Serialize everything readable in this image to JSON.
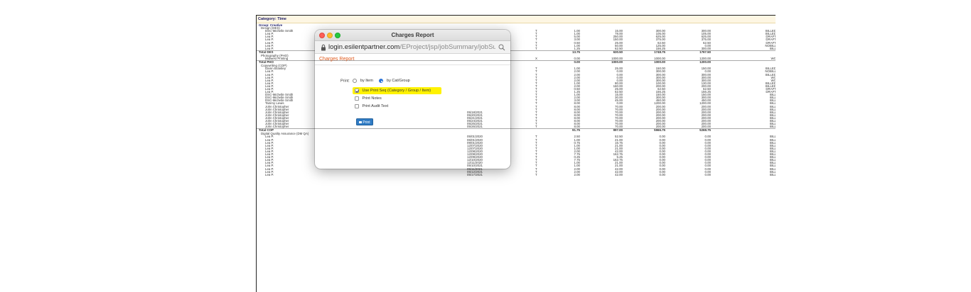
{
  "report": {
    "category": "Category: Time",
    "rows": [
      {
        "k": "h",
        "name": "Group: Creative"
      },
      {
        "k": "h1",
        "name": "Design (DES)"
      },
      {
        "k": "d",
        "name": "DSC-Michelle Smith",
        "type": "T",
        "hrs": "1.00",
        "rate": "15.00",
        "amt": "300.00",
        "bill": "300.00",
        "stat": "BILLED"
      },
      {
        "k": "d",
        "name": "Lea P.",
        "type": "T",
        "hrs": "1.00",
        "rate": "78.00",
        "amt": "105.00",
        "bill": "105.00",
        "stat": "BILLED"
      },
      {
        "k": "d",
        "name": "Lea P.",
        "type": "T",
        "hrs": "5.00",
        "rate": "250.00",
        "amt": "625.00",
        "bill": "625.00",
        "stat": "DRAFT"
      },
      {
        "k": "d",
        "name": "Lea P.",
        "type": "T",
        "hrs": "3.00",
        "rate": "150.00",
        "amt": "375.00",
        "bill": "375.00",
        "stat": "DRAFT"
      },
      {
        "k": "d",
        "name": "Lea P.",
        "type": "T",
        "hrs": "0.50",
        "rate": "25.00",
        "amt": "62.50",
        "bill": "62.50",
        "stat": "DRAFT"
      },
      {
        "k": "d",
        "name": "Lea P.",
        "type": "T",
        "hrs": "1.00",
        "rate": "50.00",
        "amt": "125.00",
        "bill": "0.00",
        "stat": "NOBILL"
      },
      {
        "k": "d",
        "name": "Lea P.",
        "type": "T",
        "hrs": "1.25",
        "rate": "62.50",
        "amt": "156.25",
        "bill": "300.00",
        "stat": "BILL"
      },
      {
        "k": "tot",
        "name": "Total DES",
        "hrs": "13.75",
        "rate": "630.50",
        "amt": "1748.75",
        "bill": "1767.50"
      },
      {
        "k": "gap"
      },
      {
        "k": "h2",
        "name": "Photography (PHO)"
      },
      {
        "k": "d",
        "name": "Midwest Printing",
        "type": "X",
        "hrs": "0.00",
        "rate": "1000.00",
        "amt": "1000.00",
        "bill": "1200.00",
        "stat": "WO"
      },
      {
        "k": "tot",
        "name": "Total PHO",
        "hrs": "0.00",
        "rate": "1000.00",
        "amt": "1000.00",
        "bill": "1200.00"
      },
      {
        "k": "gap"
      },
      {
        "k": "h2",
        "name": "Copywriting (COP)"
      },
      {
        "k": "d",
        "name": "Damn Brantley",
        "type": "T",
        "hrs": "1.00",
        "rate": "25.00",
        "amt": "150.00",
        "bill": "150.00",
        "stat": "BILLED"
      },
      {
        "k": "d",
        "name": "Lea P.",
        "type": "T",
        "hrs": "2.00",
        "rate": "0.00",
        "amt": "300.00",
        "bill": "0.00",
        "stat": "NOBILL"
      },
      {
        "k": "d",
        "name": "Lea P.",
        "type": "T",
        "hrs": "2.00",
        "rate": "0.00",
        "amt": "300.00",
        "bill": "300.00",
        "stat": "BILLED"
      },
      {
        "k": "d",
        "name": "Lea P.",
        "type": "T",
        "hrs": "2.00",
        "rate": "0.00",
        "amt": "300.00",
        "bill": "300.00",
        "stat": "WO"
      },
      {
        "k": "d",
        "name": "Lea P.",
        "type": "T",
        "hrs": "2.00",
        "rate": "0.00",
        "amt": "300.00",
        "bill": "300.00",
        "stat": "WO"
      },
      {
        "k": "d",
        "name": "Lea P.",
        "type": "T",
        "hrs": "1.00",
        "rate": "80.00",
        "amt": "100.00",
        "bill": "130.00",
        "stat": "BILLED"
      },
      {
        "k": "d",
        "name": "Lea P.",
        "type": "T",
        "hrs": "2.00",
        "rate": "160.00",
        "amt": "200.00",
        "bill": "200.00",
        "stat": "BILLED"
      },
      {
        "k": "d",
        "name": "Lea P.",
        "type": "T",
        "hrs": "0.50",
        "rate": "25.00",
        "amt": "62.50",
        "bill": "62.50",
        "stat": "DRAFT"
      },
      {
        "k": "d",
        "name": "Lea P.",
        "type": "T",
        "hrs": "1.25",
        "rate": "62.50",
        "amt": "156.25",
        "bill": "156.25",
        "stat": "DRAFT"
      },
      {
        "k": "d",
        "name": "DSC-Michelle Smith",
        "type": "T",
        "hrs": "1.00",
        "rate": "15.00",
        "amt": "150.00",
        "bill": "150.00",
        "stat": "BILL"
      },
      {
        "k": "d",
        "name": "DSC-Michelle Smith",
        "type": "T",
        "hrs": "2.00",
        "rate": "30.00",
        "amt": "300.00",
        "bill": "300.00",
        "stat": "BILL"
      },
      {
        "k": "d",
        "name": "DSC-Michelle Smith",
        "type": "T",
        "hrs": "3.00",
        "rate": "45.00",
        "amt": "450.00",
        "bill": "450.00",
        "stat": "BILL"
      },
      {
        "k": "d",
        "name": "Tammy Lewis",
        "type": "T",
        "hrs": "8.00",
        "rate": "0.00",
        "amt": "1200.00",
        "bill": "1200.00",
        "stat": "BILL"
      },
      {
        "k": "d",
        "name": "John Christopher",
        "type": "T",
        "hrs": "8.00",
        "rate": "70.00",
        "amt": "200.00",
        "bill": "200.00",
        "stat": "BILL"
      },
      {
        "k": "d",
        "name": "John Christopher",
        "type": "T",
        "hrs": "8.00",
        "rate": "70.00",
        "amt": "200.00",
        "bill": "200.00",
        "stat": "BILL"
      },
      {
        "k": "d",
        "name": "John Christopher",
        "date": "05/18/2021",
        "type": "T",
        "hrs": "8.00",
        "rate": "70.00",
        "amt": "200.00",
        "bill": "200.00",
        "stat": "BILL"
      },
      {
        "k": "d",
        "name": "John Christopher",
        "date": "05/20/2021",
        "type": "T",
        "hrs": "8.00",
        "rate": "70.00",
        "amt": "200.00",
        "bill": "200.00",
        "stat": "BILL"
      },
      {
        "k": "d",
        "name": "John Christopher",
        "date": "05/21/2021",
        "type": "T",
        "hrs": "8.00",
        "rate": "70.00",
        "amt": "200.00",
        "bill": "200.00",
        "stat": "BILL"
      },
      {
        "k": "d",
        "name": "John Christopher",
        "date": "05/24/2021",
        "type": "T",
        "hrs": "8.00",
        "rate": "70.00",
        "amt": "200.00",
        "bill": "200.00",
        "stat": "BILL"
      },
      {
        "k": "d",
        "name": "John Christopher",
        "date": "05/25/2021",
        "type": "T",
        "hrs": "8.00",
        "rate": "70.00",
        "amt": "200.00",
        "bill": "200.00",
        "stat": "BILL"
      },
      {
        "k": "d",
        "name": "John Christopher",
        "date": "05/26/2021",
        "type": "T",
        "hrs": "8.00",
        "rate": "70.00",
        "amt": "200.00",
        "bill": "200.00",
        "stat": "BILL"
      },
      {
        "k": "tot",
        "name": "Total COP",
        "hrs": "91.75",
        "rate": "997.00",
        "amt": "5966.75",
        "bill": "5268.75"
      },
      {
        "k": "gap"
      },
      {
        "k": "h2",
        "name": "Digital Quality Assurance (DM QA)"
      },
      {
        "k": "d",
        "name": "Lea P.",
        "date": "05/01/2020",
        "type": "T",
        "hrs": "2.50",
        "rate": "52.50",
        "amt": "0.00",
        "bill": "0.00",
        "stat": "BILL"
      },
      {
        "k": "d",
        "name": "Lea P.",
        "date": "06/01/2020",
        "type": "T",
        "hrs": "1.00",
        "rate": "21.00",
        "amt": "0.00",
        "bill": "0.00",
        "stat": "BILL"
      },
      {
        "k": "d",
        "name": "Lea P.",
        "date": "09/01/2020",
        "type": "T",
        "hrs": "0.75",
        "rate": "15.75",
        "amt": "0.00",
        "bill": "0.00",
        "stat": "BILL"
      },
      {
        "k": "d",
        "name": "Lea P.",
        "date": "12/07/2020",
        "type": "T",
        "hrs": "1.00",
        "rate": "21.00",
        "amt": "0.00",
        "bill": "0.00",
        "stat": "BILL"
      },
      {
        "k": "d",
        "name": "Lea P.",
        "date": "12/07/2020",
        "type": "T",
        "hrs": "1.00",
        "rate": "21.00",
        "amt": "0.00",
        "bill": "0.00",
        "stat": "BILL"
      },
      {
        "k": "d",
        "name": "Lea P.",
        "date": "12/08/2020",
        "type": "T",
        "hrs": "2.00",
        "rate": "42.00",
        "amt": "0.00",
        "bill": "0.00",
        "stat": "BILL"
      },
      {
        "k": "d",
        "name": "Lea P.",
        "date": "12/08/2020",
        "type": "T",
        "hrs": "7.75",
        "rate": "162.75",
        "amt": "0.00",
        "bill": "0.00",
        "stat": "BILL"
      },
      {
        "k": "d",
        "name": "Lea P.",
        "date": "12/09/2020",
        "type": "T",
        "hrs": "0.25",
        "rate": "5.25",
        "amt": "0.00",
        "bill": "0.00",
        "stat": "BILL"
      },
      {
        "k": "d",
        "name": "Lea P.",
        "date": "12/10/2020",
        "type": "T",
        "hrs": "7.75",
        "rate": "162.75",
        "amt": "0.00",
        "bill": "0.00",
        "stat": "BILL"
      },
      {
        "k": "d",
        "name": "Lea P.",
        "date": "12/11/2020",
        "type": "T",
        "hrs": "1.00",
        "rate": "21.00",
        "amt": "0.00",
        "bill": "0.00",
        "stat": "BILL"
      },
      {
        "k": "d",
        "name": "Lea P.",
        "date": "05/10/2021",
        "type": "T",
        "hrs": "1.00",
        "rate": "21.00",
        "amt": "0.00",
        "bill": "0.00",
        "stat": "BILL"
      },
      {
        "k": "d",
        "name": "Lea P.",
        "date": "05/11/2021",
        "type": "T",
        "hrs": "2.00",
        "rate": "42.00",
        "amt": "0.00",
        "bill": "0.00",
        "stat": "BILL"
      },
      {
        "k": "d",
        "name": "Lea P.",
        "date": "05/12/2021",
        "type": "T",
        "hrs": "2.00",
        "rate": "42.00",
        "amt": "0.00",
        "bill": "0.00",
        "stat": "BILL"
      },
      {
        "k": "d",
        "name": "Lea P.",
        "date": "05/17/2021",
        "type": "T",
        "hrs": "2.00",
        "rate": "42.00",
        "amt": "0.00",
        "bill": "0.00",
        "stat": "BILL"
      }
    ]
  },
  "window": {
    "title": "Charges Report",
    "url_host": "login.esilentpartner.com",
    "url_path": "/EProject/jsp/jobSummary/jobSumChrg...",
    "page_heading": "Charges Report",
    "print_label": "Print:",
    "radio_by_item": "by Item",
    "radio_by_catgroup": "by Cat/Group",
    "opt_print_seq": "Use Print Seq (Category / Group / Item)",
    "opt_print_notes": "Print Notes",
    "opt_print_audit": "Print Audit Text",
    "print_button": "Print"
  },
  "colors": {
    "accent_orange": "#e05a1c",
    "button_blue": "#2f7bc4",
    "highlight_yellow": "#fff200"
  }
}
